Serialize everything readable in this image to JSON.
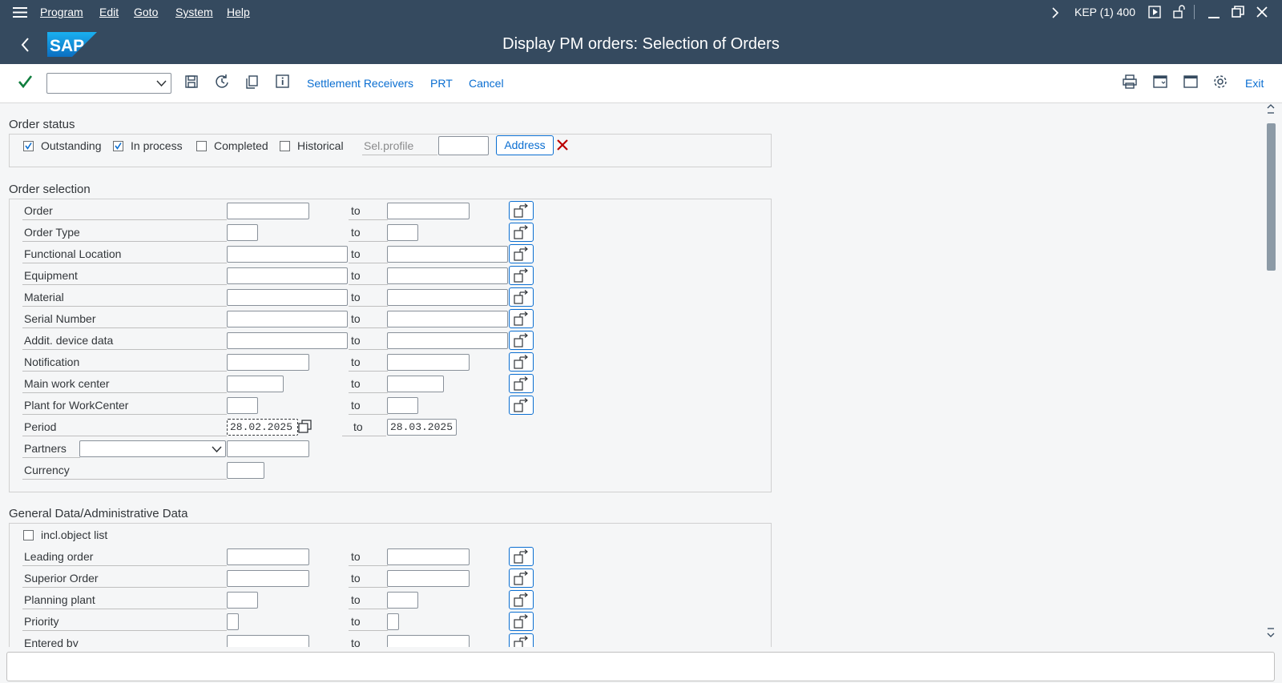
{
  "menu": {
    "items": [
      {
        "label": "Program"
      },
      {
        "label": "Edit"
      },
      {
        "label": "Goto"
      },
      {
        "label": "System"
      },
      {
        "label": "Help"
      }
    ],
    "session": "KEP (1) 400"
  },
  "title": "Display PM orders: Selection of Orders",
  "logo": "SAP",
  "toolbar": {
    "settlement": "Settlement Receivers",
    "prt": "PRT",
    "cancel": "Cancel",
    "exit": "Exit"
  },
  "order_status": {
    "title": "Order status",
    "checks": [
      {
        "label": "Outstanding",
        "checked": true
      },
      {
        "label": "In process",
        "checked": true
      },
      {
        "label": "Completed",
        "checked": false
      },
      {
        "label": "Historical",
        "checked": false
      }
    ],
    "sel_profile_label": "Sel.profile",
    "address_button": "Address"
  },
  "order_selection": {
    "title": "Order selection",
    "to_label": "to",
    "rows": [
      {
        "label": "Order",
        "from": "",
        "to": ""
      },
      {
        "label": "Order Type",
        "from": "",
        "to": ""
      },
      {
        "label": "Functional Location",
        "from": "",
        "to": ""
      },
      {
        "label": "Equipment",
        "from": "",
        "to": ""
      },
      {
        "label": "Material",
        "from": "",
        "to": ""
      },
      {
        "label": "Serial Number",
        "from": "",
        "to": ""
      },
      {
        "label": "Addit. device data",
        "from": "",
        "to": ""
      },
      {
        "label": "Notification",
        "from": "",
        "to": ""
      },
      {
        "label": "Main work center",
        "from": "",
        "to": ""
      },
      {
        "label": "Plant for WorkCenter",
        "from": "",
        "to": ""
      },
      {
        "label": "Period",
        "from": "28.02.2025",
        "to": "28.03.2025"
      },
      {
        "label": "Partners",
        "from": "",
        "to": ""
      },
      {
        "label": "Currency",
        "from": "",
        "to": ""
      }
    ]
  },
  "general": {
    "title": "General Data/Administrative Data",
    "incl_label": "incl.object list",
    "to_label": "to",
    "rows": [
      {
        "label": "Leading order"
      },
      {
        "label": "Superior Order"
      },
      {
        "label": "Planning plant"
      },
      {
        "label": "Priority"
      },
      {
        "label": "Entered by"
      }
    ]
  }
}
